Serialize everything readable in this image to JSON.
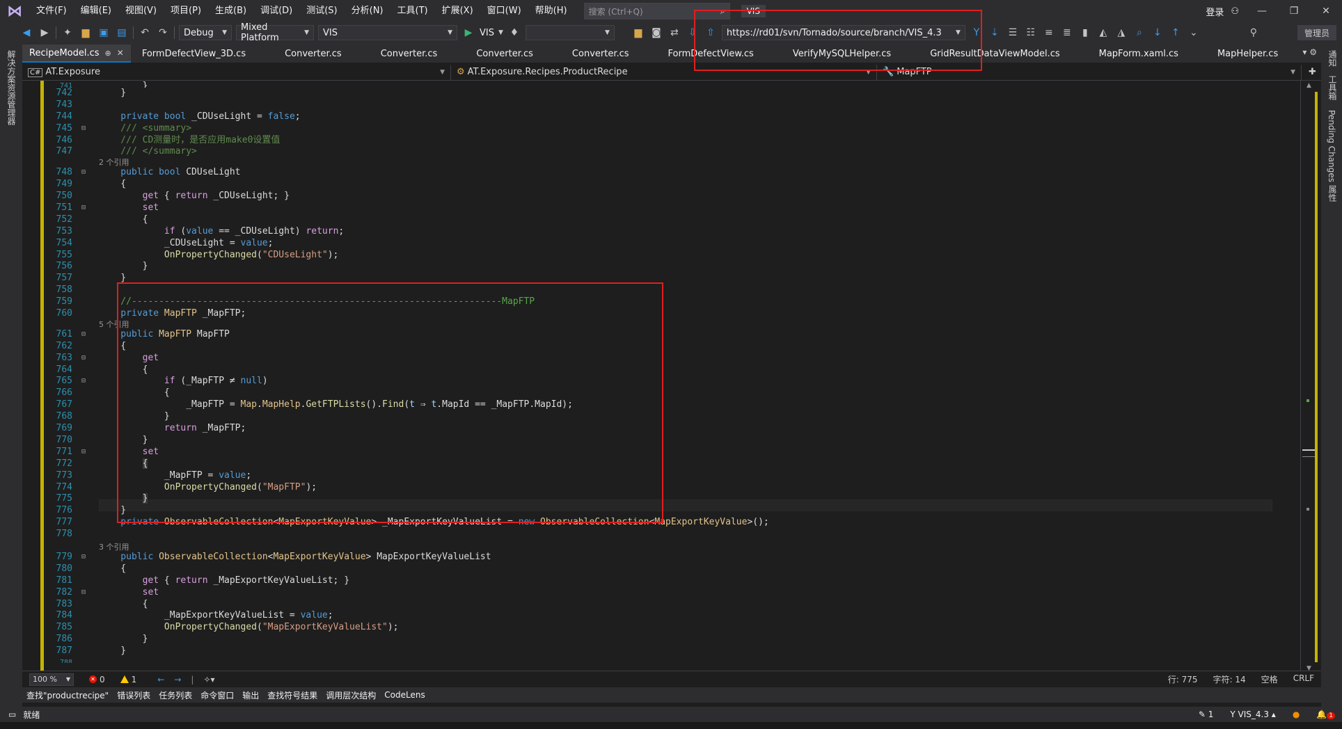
{
  "menubar": {
    "items": [
      "文件(F)",
      "编辑(E)",
      "视图(V)",
      "项目(P)",
      "生成(B)",
      "调试(D)",
      "测试(S)",
      "分析(N)",
      "工具(T)",
      "扩展(X)",
      "窗口(W)",
      "帮助(H)"
    ],
    "search_placeholder": "搜索 (Ctrl+Q)",
    "solution_name": "VIS",
    "login": "登录"
  },
  "toolbar": {
    "config": "Debug",
    "platform": "Mixed Platform",
    "project": "VIS",
    "run_label": "VIS",
    "svn_url": "https://rd01/svn/Tornado/source/branch/VIS_4.3",
    "manage": "管理员"
  },
  "left_panel": {
    "label": "解决方案资源管理器"
  },
  "right_panel": {
    "labels": [
      "通知",
      "工具箱",
      "Pending Changes",
      "属性"
    ]
  },
  "tabs": [
    {
      "label": "RecipeModel.cs",
      "active": true
    },
    {
      "label": "FormDefectView_3D.cs"
    },
    {
      "label": "Converter.cs"
    },
    {
      "label": "Converter.cs"
    },
    {
      "label": "Converter.cs"
    },
    {
      "label": "Converter.cs"
    },
    {
      "label": "FormDefectView.cs"
    },
    {
      "label": "VerifyMySQLHelper.cs"
    },
    {
      "label": "GridResultDataViewModel.cs"
    },
    {
      "label": "MapForm.xaml.cs"
    },
    {
      "label": "MapHelper.cs"
    }
  ],
  "nav": {
    "project": "AT.Exposure",
    "type": "AT.Exposure.Recipes.ProductRecipe",
    "member": "MapFTP"
  },
  "status": {
    "zoom": "100 %",
    "errors": "0",
    "warnings": "1",
    "line": "行: 775",
    "char": "字符: 14",
    "spaces": "空格",
    "eol": "CRLF"
  },
  "bottom_tabs": [
    "查找\"productrecipe\"",
    "错误列表",
    "任务列表",
    "命令窗口",
    "输出",
    "查找符号结果",
    "调用层次结构",
    "CodeLens"
  ],
  "statusbar": {
    "ready": "就绪",
    "pending": "1",
    "branch": "VIS_4.3",
    "notif": "1"
  },
  "lens": {
    "r2": "2 个引用",
    "r5": "5 个引用",
    "r3": "3 个引用"
  }
}
